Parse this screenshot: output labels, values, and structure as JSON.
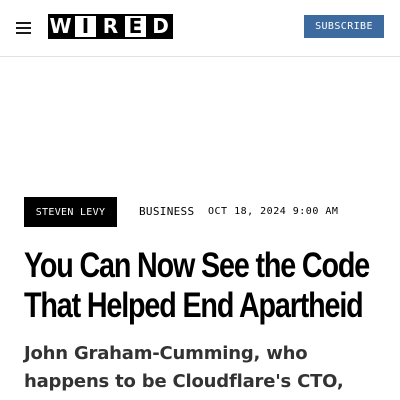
{
  "header": {
    "menu_icon": "hamburger-menu-icon",
    "logo_letters": [
      "W",
      "I",
      "R",
      "E",
      "D"
    ],
    "subscribe_label": "SUBSCRIBE",
    "accent_color": "#3d6a9f"
  },
  "article": {
    "author": "STEVEN LEVY",
    "category": "BUSINESS",
    "date": "OCT 18, 2024 9:00 AM",
    "headline": "You Can Now See the Code That Helped End Apartheid",
    "dek": "John Graham-Cumming, who happens to be Cloudflare's CTO,"
  }
}
